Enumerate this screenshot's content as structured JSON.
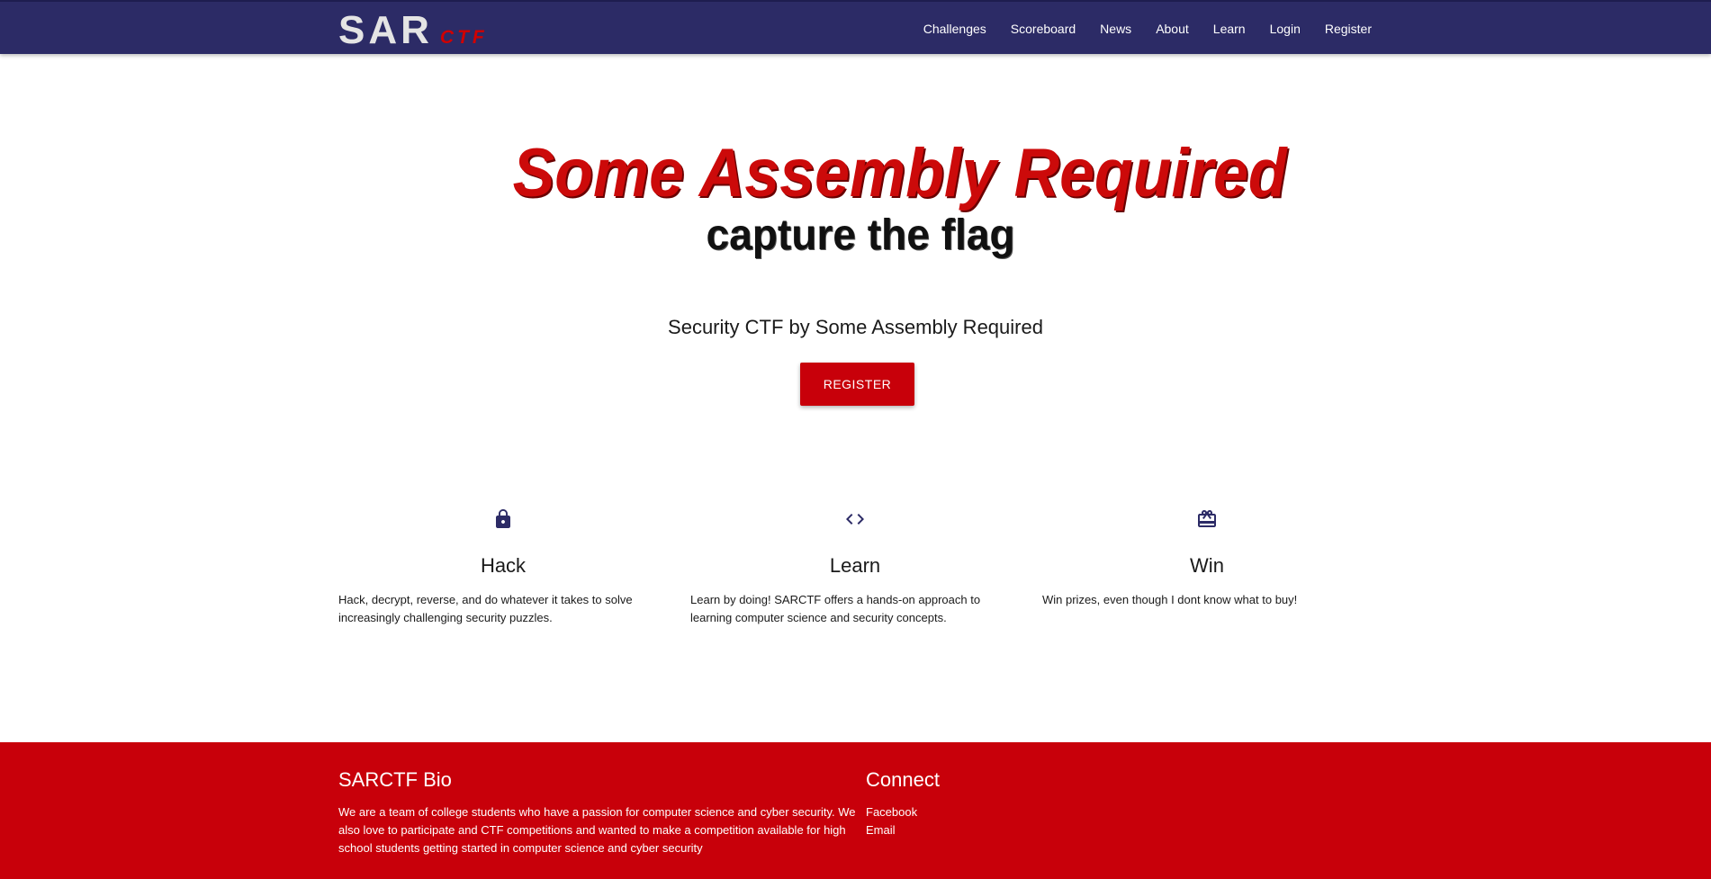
{
  "navbar": {
    "brand_main": "SAR",
    "brand_sub": "CTF",
    "links": [
      "Challenges",
      "Scoreboard",
      "News",
      "About",
      "Learn",
      "Login",
      "Register"
    ]
  },
  "hero": {
    "logo_title": "Some Assembly Required",
    "logo_subtitle": "capture the flag",
    "tagline": "Security CTF by Some Assembly Required",
    "register_label": "REGISTER"
  },
  "features": [
    {
      "icon": "lock-icon",
      "title": "Hack",
      "text": "Hack, decrypt, reverse, and do whatever it takes to solve increasingly challenging security puzzles."
    },
    {
      "icon": "code-icon",
      "title": "Learn",
      "text": "Learn by doing! SARCTF offers a hands-on approach to learning computer science and security concepts."
    },
    {
      "icon": "card-giftcard-icon",
      "title": "Win",
      "text": "Win prizes, even though I dont know what to buy!"
    }
  ],
  "footer": {
    "bio_heading": "SARCTF Bio",
    "bio_text": "We are a team of college students who have a passion for computer science and cyber security. We also love to participate and CTF competitions and wanted to make a competition available for high school students getting started in computer science and cyber security",
    "connect_heading": "Connect",
    "connect_links": [
      "Facebook",
      "Email"
    ]
  },
  "colors": {
    "navbar": "#2c2b66",
    "accent_red": "#c8000a",
    "icon": "#2c2b66"
  }
}
